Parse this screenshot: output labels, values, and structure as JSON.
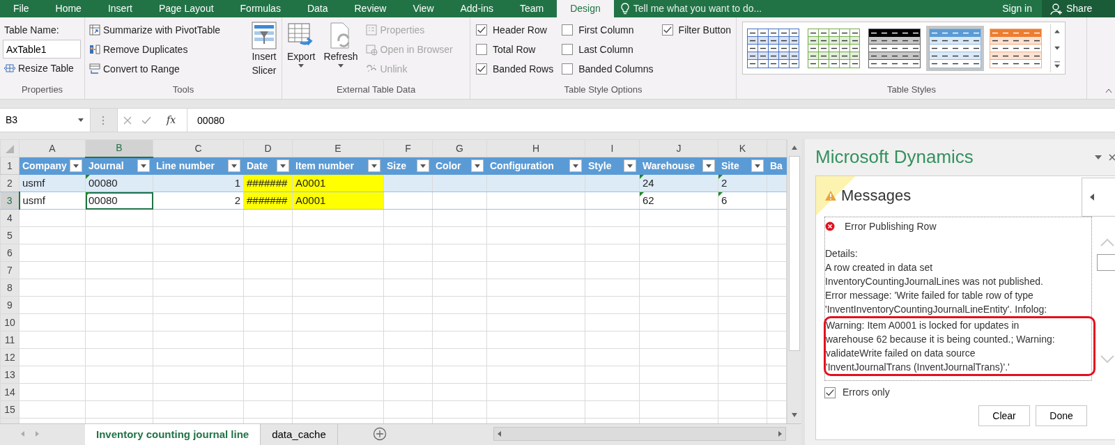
{
  "menu": {
    "tabs": [
      {
        "label": "File",
        "selected": false
      },
      {
        "label": "Home",
        "selected": false
      },
      {
        "label": "Insert",
        "selected": false
      },
      {
        "label": "Page Layout",
        "selected": false
      },
      {
        "label": "Formulas",
        "selected": false
      },
      {
        "label": "Data",
        "selected": false
      },
      {
        "label": "Review",
        "selected": false
      },
      {
        "label": "View",
        "selected": false
      },
      {
        "label": "Add-ins",
        "selected": false
      },
      {
        "label": "Team",
        "selected": false
      },
      {
        "label": "Design",
        "selected": true
      }
    ],
    "tell_me": "Tell me what you want to do...",
    "sign_in": "Sign in",
    "share": "Share"
  },
  "ribbon": {
    "properties": {
      "label": "Properties",
      "table_name_label": "Table Name:",
      "table_name": "AxTable1",
      "resize": "Resize Table"
    },
    "tools": {
      "label": "Tools",
      "commands": [
        "Summarize with PivotTable",
        "Remove Duplicates",
        "Convert to Range"
      ],
      "slicer": [
        "Insert",
        "Slicer"
      ]
    },
    "external": {
      "label": "External Table Data",
      "export": "Export",
      "refresh": "Refresh",
      "commands": [
        {
          "label": "Properties",
          "disabled": true
        },
        {
          "label": "Open in Browser",
          "disabled": true
        },
        {
          "label": "Unlink",
          "disabled": true
        }
      ]
    },
    "style_options": {
      "label": "Table Style Options",
      "columns": [
        [
          {
            "label": "Header Row",
            "checked": true
          },
          {
            "label": "Total Row",
            "checked": false
          },
          {
            "label": "Banded Rows",
            "checked": true
          }
        ],
        [
          {
            "label": "First Column",
            "checked": false
          },
          {
            "label": "Last Column",
            "checked": false
          },
          {
            "label": "Banded Columns",
            "checked": false
          }
        ],
        [
          {
            "label": "Filter Button",
            "checked": true
          }
        ]
      ]
    },
    "table_styles": {
      "label": "Table Styles",
      "styles": [
        {
          "kind": "grid",
          "color": "#4472c4",
          "selected": false
        },
        {
          "kind": "grid",
          "color": "#70ad47",
          "selected": false
        },
        {
          "kind": "header",
          "color": "#000000",
          "selected": false
        },
        {
          "kind": "header",
          "color": "#5b9bd5",
          "selected": true
        },
        {
          "kind": "header",
          "color": "#ed7d31",
          "selected": false
        }
      ]
    }
  },
  "formula_bar": {
    "name_box": "B3",
    "function_label": "fx",
    "value": "00080"
  },
  "sheet": {
    "column_letters": [
      {
        "label": "A",
        "selected": false
      },
      {
        "label": "B",
        "selected": true
      },
      {
        "label": "C",
        "selected": false
      },
      {
        "label": "D",
        "selected": false
      },
      {
        "label": "E",
        "selected": false
      },
      {
        "label": "F",
        "selected": false
      },
      {
        "label": "G",
        "selected": false
      },
      {
        "label": "H",
        "selected": false
      },
      {
        "label": "I",
        "selected": false
      },
      {
        "label": "J",
        "selected": false
      },
      {
        "label": "K",
        "selected": false
      }
    ],
    "row_numbers": [
      {
        "label": "1",
        "selected": false
      },
      {
        "label": "2",
        "selected": false
      },
      {
        "label": "3",
        "selected": true
      },
      {
        "label": "4",
        "selected": false
      },
      {
        "label": "5",
        "selected": false
      },
      {
        "label": "6",
        "selected": false
      },
      {
        "label": "7",
        "selected": false
      },
      {
        "label": "8",
        "selected": false
      },
      {
        "label": "9",
        "selected": false
      },
      {
        "label": "10",
        "selected": false
      },
      {
        "label": "11",
        "selected": false
      },
      {
        "label": "12",
        "selected": false
      },
      {
        "label": "13",
        "selected": false
      },
      {
        "label": "14",
        "selected": false
      },
      {
        "label": "15",
        "selected": false
      }
    ],
    "header": [
      {
        "label": "Company",
        "filter": true
      },
      {
        "label": "Journal",
        "filter": true
      },
      {
        "label": "Line number",
        "filter": true
      },
      {
        "label": "Date",
        "filter": true
      },
      {
        "label": "Item number",
        "filter": true
      },
      {
        "label": "Size",
        "filter": true
      },
      {
        "label": "Color",
        "filter": true
      },
      {
        "label": "Configuration",
        "filter": true
      },
      {
        "label": "Style",
        "filter": true
      },
      {
        "label": "Warehouse",
        "filter": true
      },
      {
        "label": "Site",
        "filter": true
      },
      {
        "label": "Ba",
        "filter": false
      }
    ],
    "rows": [
      {
        "banded": true,
        "cells": [
          {
            "text": "usmf"
          },
          {
            "text": "00080",
            "flagged": true,
            "selected": false
          },
          {
            "text": "1",
            "kind": "number"
          },
          {
            "text": "#######",
            "color": "#ffff00"
          },
          {
            "text": "A0001",
            "color": "#ffff00"
          },
          {},
          {},
          {},
          {},
          {
            "text": "24",
            "flagged": true
          },
          {
            "text": "2",
            "flagged": true
          },
          {}
        ]
      },
      {
        "banded": false,
        "cells": [
          {
            "text": "usmf"
          },
          {
            "text": "00080",
            "flagged": true,
            "selected": true
          },
          {
            "text": "2",
            "kind": "number"
          },
          {
            "text": "#######",
            "color": "#ffff00"
          },
          {
            "text": "A0001",
            "color": "#ffff00"
          },
          {},
          {},
          {},
          {},
          {
            "text": "62",
            "flagged": true
          },
          {
            "text": "6",
            "flagged": true
          },
          {}
        ]
      }
    ],
    "tabs": [
      {
        "label": "Inventory counting journal line",
        "selected": true
      },
      {
        "label": "data_cache",
        "selected": false
      }
    ]
  },
  "pane": {
    "title": "Microsoft Dynamics",
    "messages_title": "Messages",
    "error_title": "Error Publishing Row",
    "lines": [
      {
        "text": "Details:",
        "highlighted": false
      },
      {
        "text": "A row created in data set",
        "highlighted": false
      },
      {
        "text": "InventoryCountingJournalLines was not published.",
        "highlighted": false
      },
      {
        "text": "Error message: 'Write failed for table row of type",
        "highlighted": false
      },
      {
        "text": "'InventInventoryCountingJournalLineEntity'. Infolog:",
        "highlighted": false
      },
      {
        "text": "Warning: Item A0001 is locked for updates in",
        "highlighted": true
      },
      {
        "text": "warehouse 62 because it is being counted.; Warning:",
        "highlighted": true
      },
      {
        "text": "validateWrite failed on data source",
        "highlighted": true
      },
      {
        "text": "'InventJournalTrans (InventJournalTrans)'.'",
        "highlighted": true
      }
    ],
    "errors_only": {
      "label": "Errors only",
      "checked": true
    },
    "buttons": [
      "Clear",
      "Done"
    ]
  }
}
